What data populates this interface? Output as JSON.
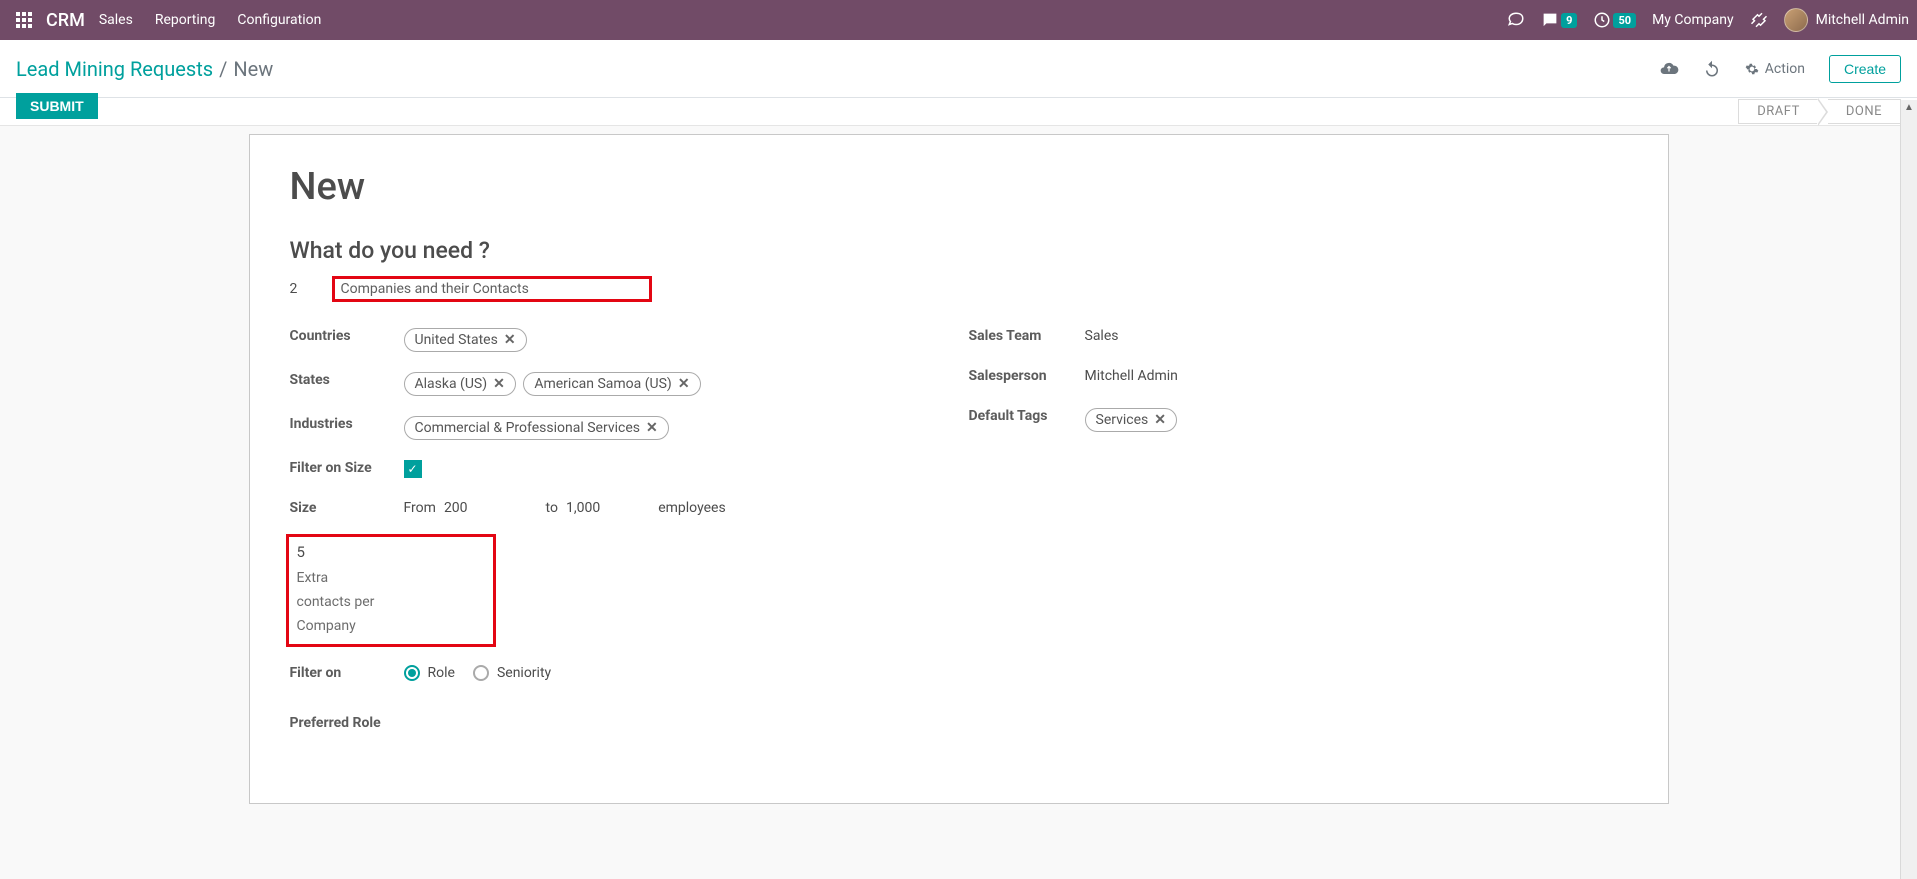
{
  "topbar": {
    "brand": "CRM",
    "menu": [
      "Sales",
      "Reporting",
      "Configuration"
    ],
    "messages_badge": "9",
    "activities_badge": "50",
    "company": "My Company",
    "user": "Mitchell Admin"
  },
  "controlbar": {
    "breadcrumb_link": "Lead Mining Requests",
    "breadcrumb_sep": "/",
    "breadcrumb_current": "New",
    "action_label": "Action",
    "create_label": "Create"
  },
  "statusbar": {
    "submit": "SUBMIT",
    "stages": [
      "DRAFT",
      "DONE"
    ]
  },
  "form": {
    "title": "New",
    "section_title": "What do you need ?",
    "leads_qty": "2",
    "need_type": "Companies and their Contacts",
    "labels": {
      "countries": "Countries",
      "states": "States",
      "industries": "Industries",
      "filter_size": "Filter on Size",
      "size": "Size",
      "from": "From",
      "to": "to",
      "employees": "employees",
      "extra_num": "5",
      "extra_text1": "Extra",
      "extra_text2": "contacts per",
      "extra_text3": "Company",
      "filter_on": "Filter on",
      "role": "Role",
      "seniority": "Seniority",
      "preferred_role": "Preferred Role",
      "sales_team": "Sales Team",
      "salesperson": "Salesperson",
      "default_tags": "Default Tags"
    },
    "countries": [
      "United States"
    ],
    "states": [
      "Alaska (US)",
      "American Samoa (US)"
    ],
    "industries": [
      "Commercial & Professional Services"
    ],
    "size_from": "200",
    "size_to": "1,000",
    "sales_team": "Sales",
    "salesperson": "Mitchell Admin",
    "default_tags": [
      "Services"
    ]
  }
}
